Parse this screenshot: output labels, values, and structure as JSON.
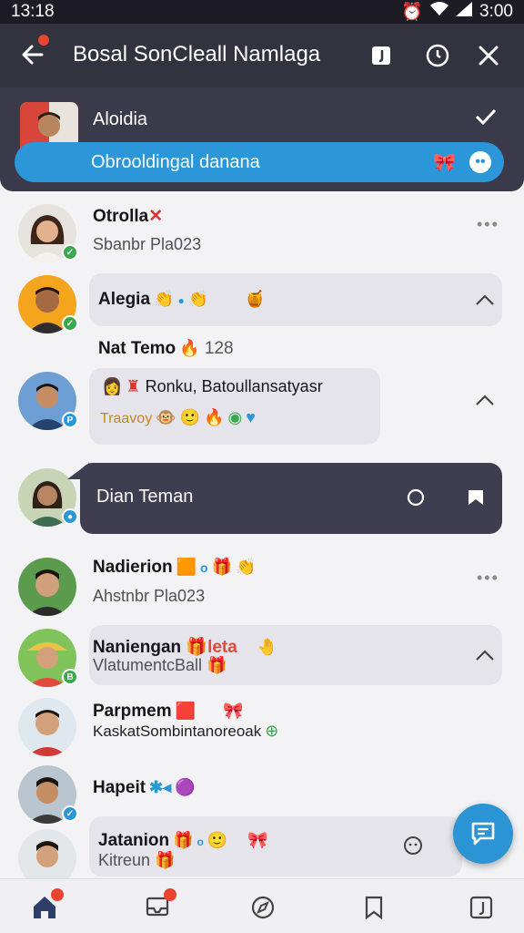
{
  "status": {
    "time": "13:18",
    "clock": "3:00"
  },
  "header": {
    "title": "Bosal SonCleall Namlaga"
  },
  "pinned": {
    "name": "Aloidia",
    "message": "Obrooldingal danana"
  },
  "chats": [
    {
      "name": "Otrolla",
      "preview": "Sbanbr Pla023"
    },
    {
      "name": "Alegia",
      "preview": ""
    },
    {
      "name": "Nat Temo",
      "preview": "128"
    },
    {
      "name": "Ronku, Batoullansatyasr",
      "preview": "Traavoy"
    },
    {
      "name": "Dian Teman",
      "preview": ""
    },
    {
      "name": "Nadierion",
      "preview": "Ahstnbr Pla023"
    },
    {
      "name": "Naniengan",
      "tag": "leta",
      "preview": "VlatumentcBall"
    },
    {
      "name": "Parpmem",
      "preview": "KaskatSombintanoreoak"
    },
    {
      "name": "Hapeit",
      "preview": ""
    },
    {
      "name": "Jatanion",
      "preview": "Kitreun"
    }
  ],
  "colors": {
    "accent": "#2b97d8",
    "dark": "#33323f",
    "badge": "#e8442f"
  }
}
